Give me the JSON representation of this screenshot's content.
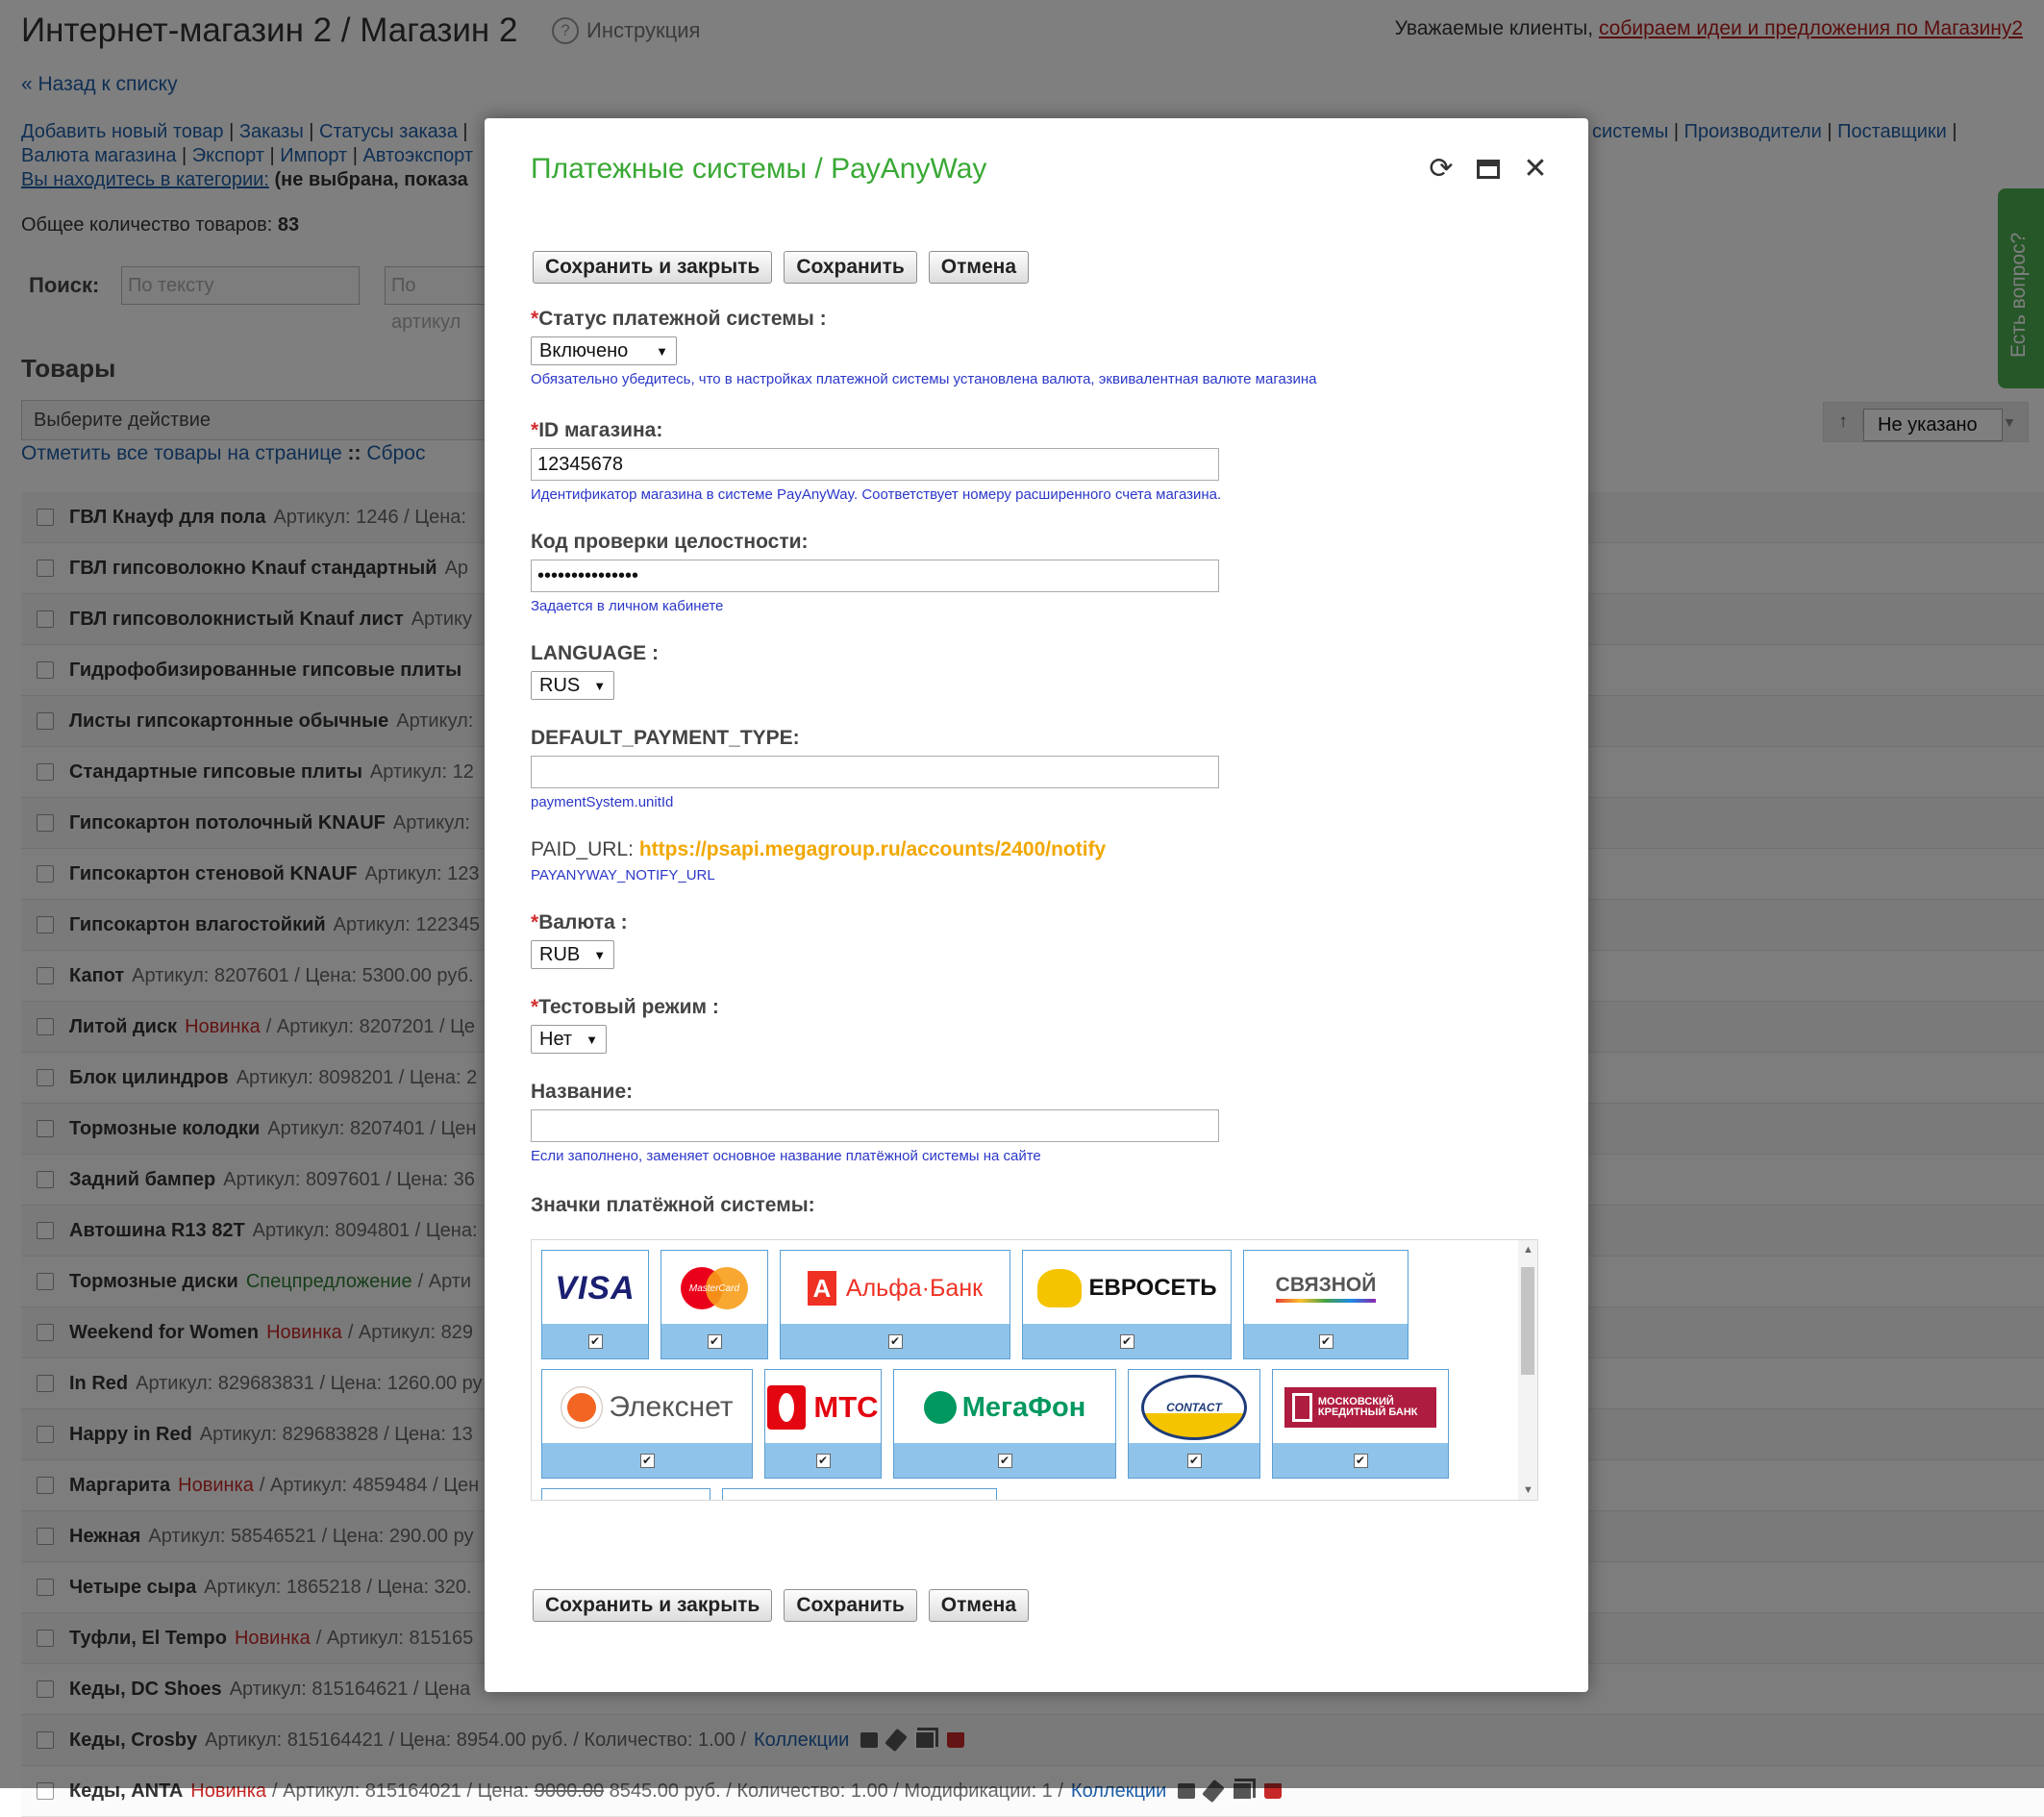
{
  "page": {
    "title": "Интернет-магазин 2 / Магазин 2",
    "help": "Инструкция",
    "ideas_prefix": "Уважаемые клиенты, ",
    "ideas_link": "собираем идеи и предложения по Магазину2",
    "back": "« Назад к списку",
    "nav1": [
      "Добавить новый товар",
      "Заказы",
      "Статусы заказа"
    ],
    "nav_right": [
      "системы",
      "Производители",
      "Поставщики"
    ],
    "nav2": [
      "Валюта магазина",
      "Экспорт",
      "Импорт",
      "Автоэкспорт"
    ],
    "category_prefix": "Вы находитесь в категории:",
    "category_value": "(не выбрана, показа",
    "count_label": "Общее количество товаров:",
    "count_value": "83",
    "search_label": "Поиск:",
    "search_text_placeholder": "По тексту",
    "search_sku_placeholder": "По артикул",
    "goods_title": "Товары",
    "action_select": "Выберите действие",
    "mark_all": "Отметить все товары на странице",
    "reset": "Сброс",
    "sort_value": "Не указано",
    "question_tab": "Есть вопрос?",
    "rows": [
      {
        "name": "ГВЛ Кнауф для пола",
        "rest": "Артикул: 1246 / Цена:"
      },
      {
        "name": "ГВЛ гипсоволокно Knauf стандартный",
        "rest": "Ар"
      },
      {
        "name": "ГВЛ гипсоволокнистый Knauf лист",
        "rest": "Артику"
      },
      {
        "name": "Гидрофобизированные гипсовые плиты",
        "rest": ""
      },
      {
        "name": "Листы гипсокартонные обычные",
        "rest": "Артикул:"
      },
      {
        "name": "Стандартные гипсовые плиты",
        "rest": "Артикул: 12"
      },
      {
        "name": "Гипсокартон потолочный KNAUF",
        "rest": "Артикул:"
      },
      {
        "name": "Гипсокартон стеновой KNAUF",
        "rest": "Артикул: 123"
      },
      {
        "name": "Гипсокартон влагостойкий",
        "rest": "Артикул: 122345"
      },
      {
        "name": "Капот",
        "rest": "Артикул: 8207601 / Цена: 5300.00 руб."
      },
      {
        "name": "Литой диск",
        "tag": "Новинка",
        "rest": "/ Артикул: 8207201 / Це"
      },
      {
        "name": "Блок цилиндров",
        "rest": "Артикул: 8098201 / Цена: 2"
      },
      {
        "name": "Тормозные колодки",
        "rest": "Артикул: 8207401 / Цен"
      },
      {
        "name": "Задний бампер",
        "rest": "Артикул: 8097601 / Цена: 36"
      },
      {
        "name": "Автошина R13 82T",
        "rest": "Артикул: 8094801 / Цена:"
      },
      {
        "name": "Тормозные диски",
        "spec": "Спецпредложение",
        "rest": "/ Арти"
      },
      {
        "name": "Weekend for Women",
        "tag": "Новинка",
        "rest": "/ Артикул: 829"
      },
      {
        "name": "In Red",
        "rest": "Артикул: 829683831 / Цена: 1260.00 ру"
      },
      {
        "name": "Happy in Red",
        "rest": "Артикул: 829683828 / Цена: 13"
      },
      {
        "name": "Маргарита",
        "tag": "Новинка",
        "rest": "/ Артикул: 4859484 / Цен"
      },
      {
        "name": "Нежная",
        "rest": "Артикул: 58546521 / Цена: 290.00 ру"
      },
      {
        "name": "Четыре сыра",
        "rest": "Артикул: 1865218 / Цена: 320."
      },
      {
        "name": "Туфли, El Tempo",
        "tag": "Новинка",
        "rest": "/ Артикул: 815165"
      },
      {
        "name": "Кеды, DC Shoes",
        "rest": "Артикул: 815164621 / Цена"
      },
      {
        "name": "Кеды, Crosby",
        "rest": "Артикул: 815164421 / Цена: 8954.00 руб. / Количество: 1.00 /",
        "coll": "Коллекции",
        "icons": true
      },
      {
        "name": "Кеды, ANTA",
        "tag": "Новинка",
        "rest": "/ Артикул: 815164021 / Цена:",
        "old": "9000.00",
        "rest2": "8545.00 руб. / Количество: 1.00 / Модификации: 1 /",
        "coll": "Коллекции",
        "icons": true
      }
    ]
  },
  "modal": {
    "title": "Платежные системы / PayAnyWay",
    "tools": {
      "refresh_icon": "⟳",
      "maximize_icon": "maximize",
      "close_icon": "✕"
    },
    "buttons": {
      "save_close": "Сохранить и закрыть",
      "save": "Сохранить",
      "cancel": "Отмена"
    },
    "required_mark": "*",
    "status": {
      "label": "Статус платежной системы :",
      "value": "Включено",
      "hint": "Обязательно убедитесь, что в настройках платежной системы установлена валюта, эквивалентная валюте магазина"
    },
    "shop_id": {
      "label": "ID магазина:",
      "value": "12345678",
      "hint": "Идентификатор магазина в системе PayAnyWay. Соответствует номеру расширенного счета магазина."
    },
    "integrity": {
      "label": "Код проверки целостности:",
      "value": "•••••••••••••••",
      "hint": "Задается в личном кабинете"
    },
    "language": {
      "label": "LANGUAGE :",
      "value": "RUS"
    },
    "payment_type": {
      "label": "DEFAULT_PAYMENT_TYPE:",
      "value": "",
      "hint": "paymentSystem.unitId"
    },
    "paid_url": {
      "label": "PAID_URL:",
      "value": "https://psapi.megagroup.ru/accounts/2400/notify",
      "hint": "PAYANYWAY_NOTIFY_URL"
    },
    "currency": {
      "label": "Валюта :",
      "value": "RUB"
    },
    "test_mode": {
      "label": "Тестовый режим :",
      "value": "Нет"
    },
    "name": {
      "label": "Название:",
      "value": "",
      "hint": "Если заполнено, заменяет основное название платёжной системы на сайте"
    },
    "icons_label": "Значки платёжной системы:",
    "payment_icons": [
      {
        "text": "VISA",
        "icon": "visa-logo",
        "checked": "✔"
      },
      {
        "text": "MasterCard",
        "icon": "mastercard-logo",
        "checked": "✔"
      },
      {
        "text": "Альфа·Банк",
        "icon": "alfa-bank-logo",
        "checked": "✔"
      },
      {
        "text": "ЕВРОСЕТЬ",
        "icon": "euroset-logo",
        "checked": "✔"
      },
      {
        "text": "СВЯЗНОЙ",
        "icon": "svyaznoy-logo",
        "checked": "✔"
      },
      {
        "text": "Элекснет",
        "icon": "eleksnet-logo",
        "checked": "✔"
      },
      {
        "text": "МТС",
        "icon": "mts-logo",
        "checked": "✔"
      },
      {
        "text": "МегаФон",
        "icon": "megafon-logo",
        "checked": "✔"
      },
      {
        "text": "CONTACT",
        "icon": "contact-logo",
        "checked": "✔"
      },
      {
        "text": "МОСКОВСКИЙ КРЕДИТНЫЙ БАНК",
        "icon": "mkb-logo",
        "checked": "✔"
      }
    ]
  }
}
